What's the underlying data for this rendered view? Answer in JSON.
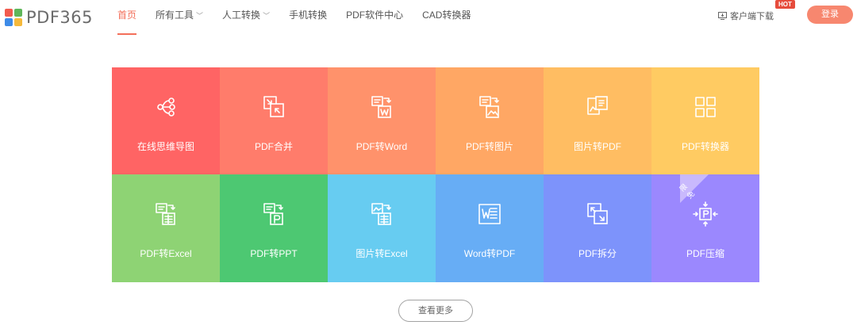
{
  "brand": {
    "name": "PDF365",
    "logo_colors": [
      "#f15b4e",
      "#5fb65a",
      "#3d8be8",
      "#f6b93b"
    ]
  },
  "nav": {
    "items": [
      {
        "label": "首页",
        "active": true,
        "dropdown": false
      },
      {
        "label": "所有工具",
        "active": false,
        "dropdown": true
      },
      {
        "label": "人工转换",
        "active": false,
        "dropdown": true
      },
      {
        "label": "手机转换",
        "active": false,
        "dropdown": false
      },
      {
        "label": "PDF软件中心",
        "active": false,
        "dropdown": false
      },
      {
        "label": "CAD转换器",
        "active": false,
        "dropdown": false
      }
    ],
    "accent_color": "#f36f5a"
  },
  "header_right": {
    "client_download": "客户端下载",
    "hot_badge": "HOT",
    "login": "登录"
  },
  "tools": [
    {
      "label": "在线思维导图",
      "icon": "mindmap-icon",
      "color": "#ff6464"
    },
    {
      "label": "PDF合并",
      "icon": "merge-icon",
      "color": "#ff7c6b"
    },
    {
      "label": "PDF转Word",
      "icon": "pdf-to-word-icon",
      "color": "#ff926b"
    },
    {
      "label": "PDF转图片",
      "icon": "pdf-to-image-icon",
      "color": "#ffa764"
    },
    {
      "label": "图片转PDF",
      "icon": "image-to-pdf-icon",
      "color": "#ffbd62"
    },
    {
      "label": "PDF转换器",
      "icon": "grid-icon",
      "color": "#ffcb62"
    },
    {
      "label": "PDF转Excel",
      "icon": "pdf-to-excel-icon",
      "color": "#8ed374"
    },
    {
      "label": "PDF转PPT",
      "icon": "pdf-to-ppt-icon",
      "color": "#4dc872"
    },
    {
      "label": "图片转Excel",
      "icon": "image-to-excel-icon",
      "color": "#67ccf1"
    },
    {
      "label": "Word转PDF",
      "icon": "word-to-pdf-icon",
      "color": "#67adf5"
    },
    {
      "label": "PDF拆分",
      "icon": "split-icon",
      "color": "#7d93fb"
    },
    {
      "label": "PDF压缩",
      "icon": "compress-icon",
      "color": "#9b88fe",
      "ribbon": "限免"
    }
  ],
  "more_button": "查看更多"
}
